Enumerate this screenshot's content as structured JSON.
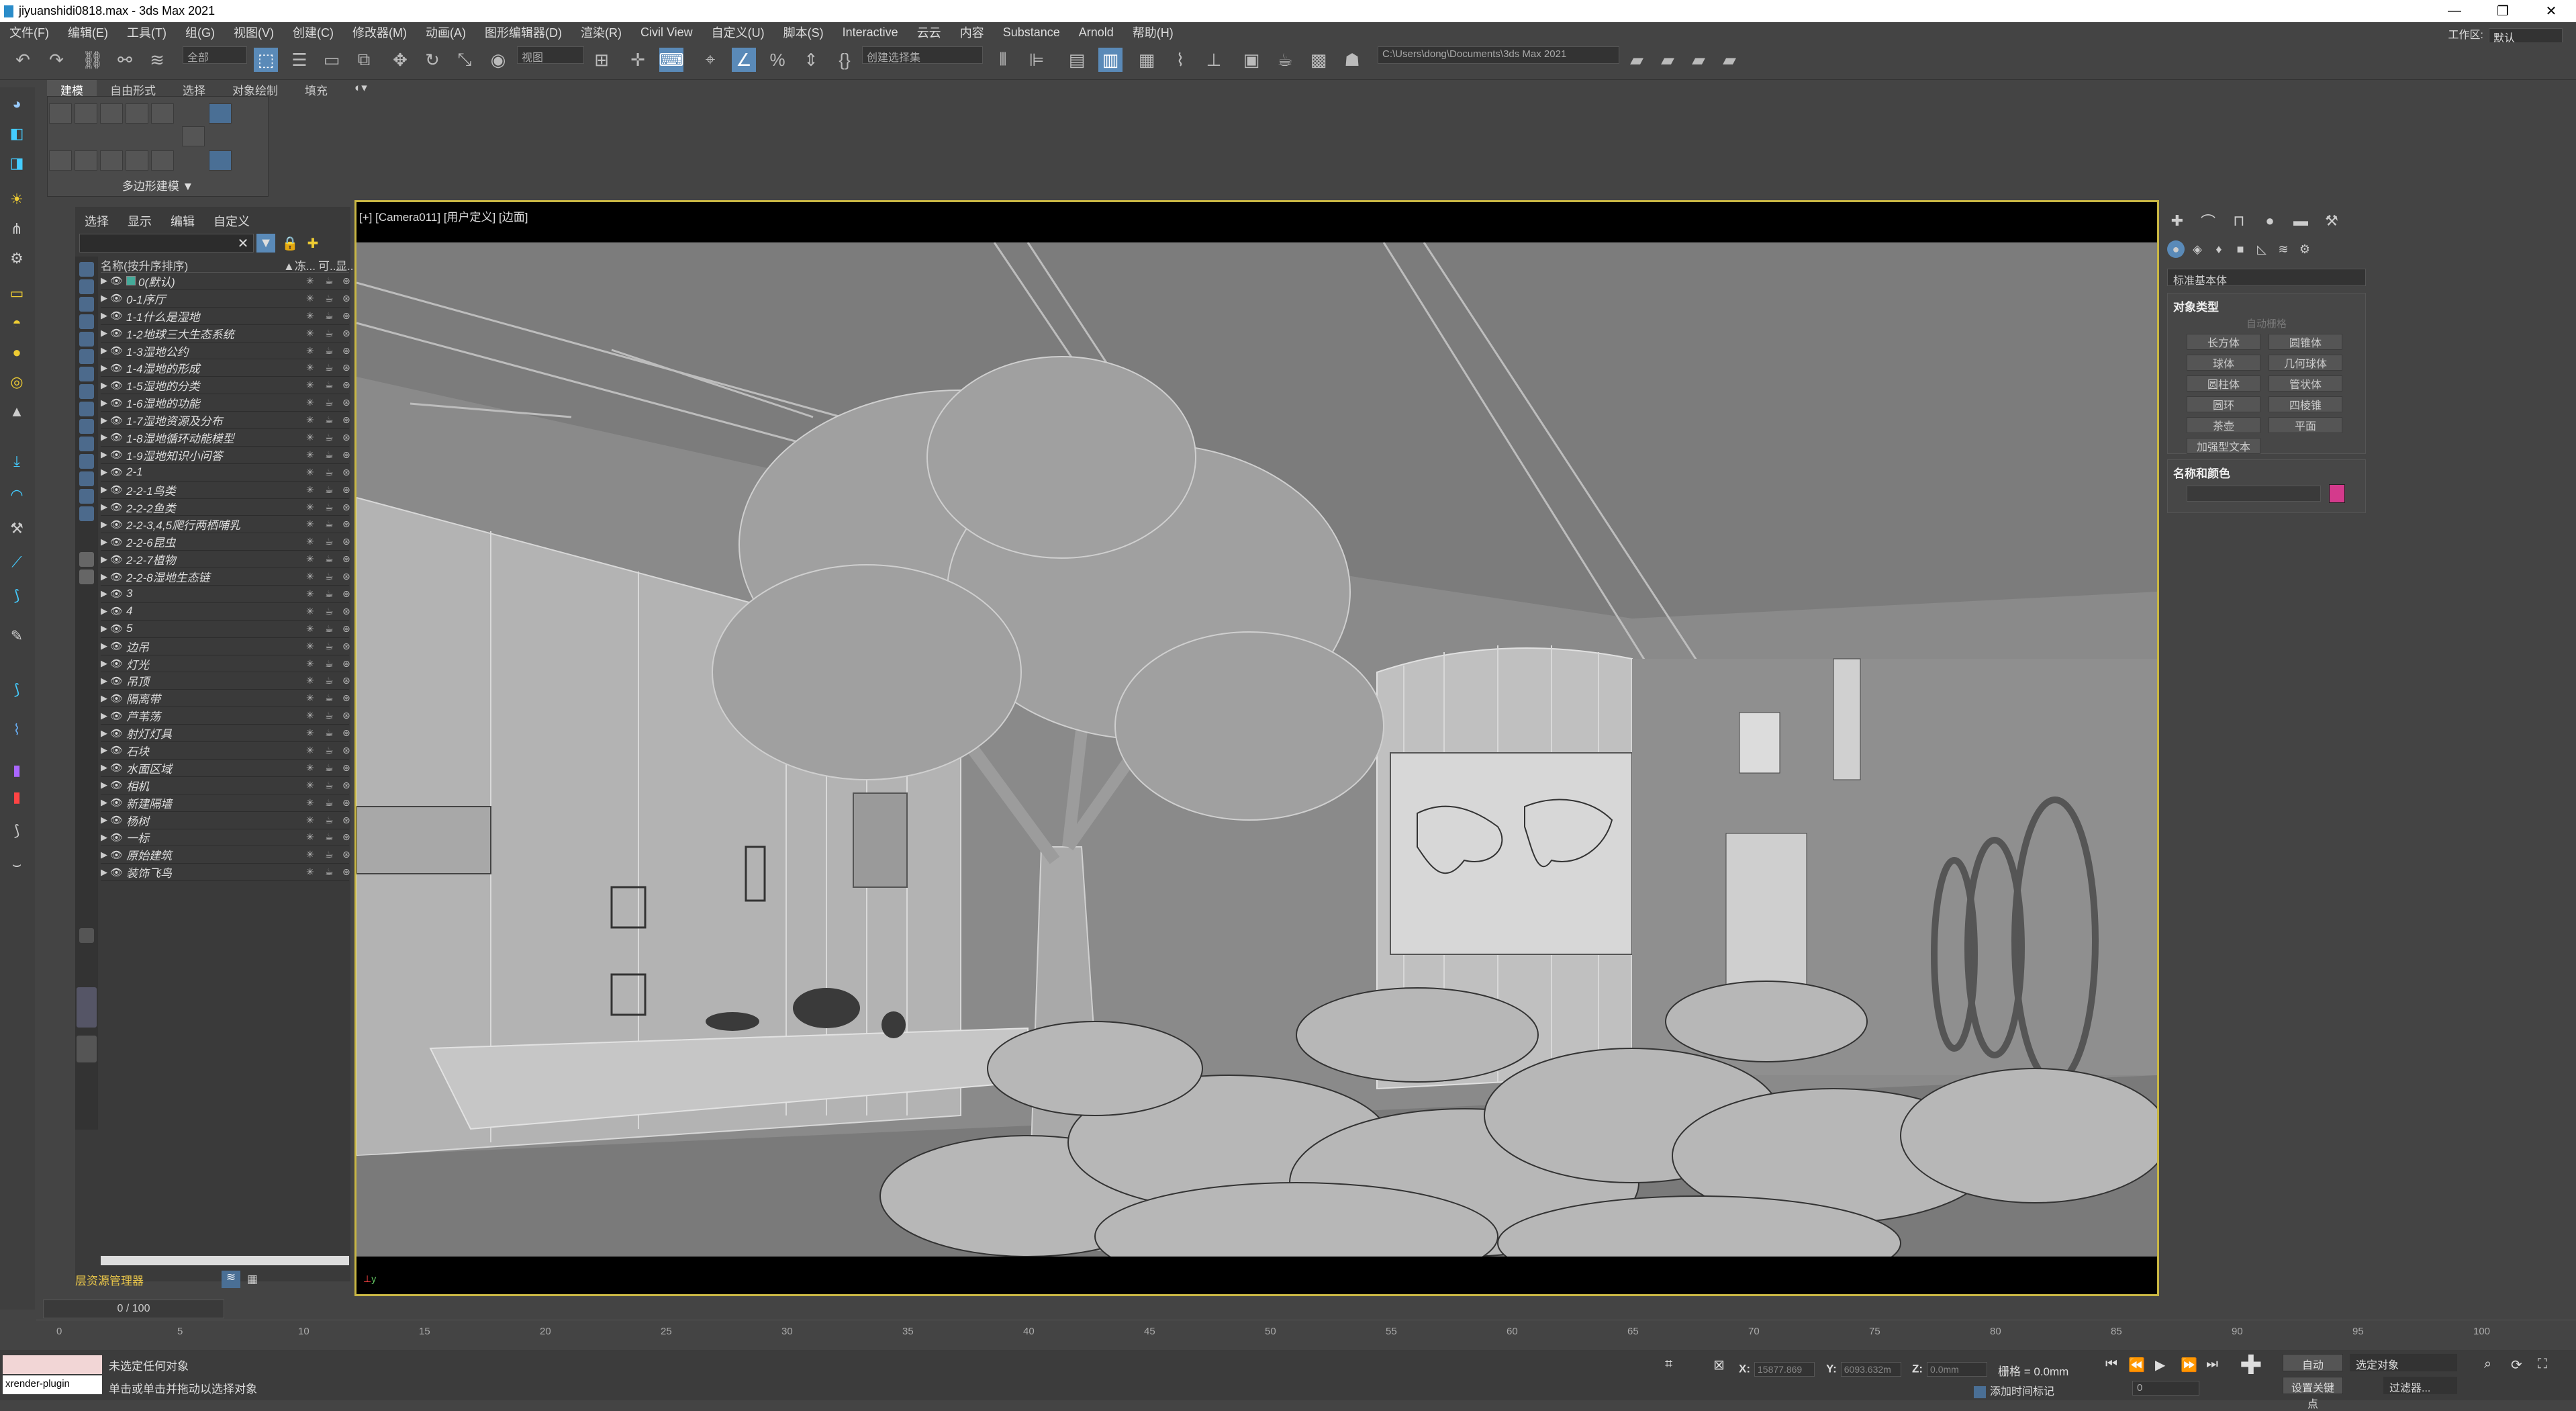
{
  "window": {
    "title": "jiyuanshidi0818.max - 3ds Max 2021",
    "minimize": "—",
    "restore": "❐",
    "close": "✕"
  },
  "menu": [
    "文件(F)",
    "编辑(E)",
    "工具(T)",
    "组(G)",
    "视图(V)",
    "创建(C)",
    "修改器(M)",
    "动画(A)",
    "图形编辑器(D)",
    "渲染(R)",
    "Civil View",
    "自定义(U)",
    "脚本(S)",
    "Interactive",
    "云云",
    "内容",
    "Substance",
    "Arnold",
    "帮助(H)"
  ],
  "workspace": {
    "label": "工作区:",
    "value": "默认"
  },
  "toolbar": {
    "filter": "全部",
    "refcoord": "视图",
    "selset": "创建选择集",
    "path": "C:\\Users\\dong\\Documents\\3ds Max 2021"
  },
  "ribbon": {
    "tabs": [
      "建模",
      "自由形式",
      "选择",
      "对象绘制",
      "填充"
    ],
    "group_label": "多边形建模 ▼"
  },
  "scene_explorer": {
    "tabs": [
      "选择",
      "显示",
      "编辑",
      "自定义"
    ],
    "header": {
      "name": "名称(按升序排序)",
      "c1": "▲冻...",
      "c2": "可...",
      "c3": "显..."
    },
    "footer": "层资源管理器",
    "rows": [
      "0(默认)",
      "0-1序厅",
      "1-1什么是湿地",
      "1-2地球三大生态系统",
      "1-3湿地公约",
      "1-4湿地的形成",
      "1-5湿地的分类",
      "1-6湿地的功能",
      "1-7湿地资源及分布",
      "1-8湿地循环动能模型",
      "1-9湿地知识小问答",
      "2-1",
      "2-2-1鸟类",
      "2-2-2鱼类",
      "2-2-3,4,5爬行两栖哺乳",
      "2-2-6昆虫",
      "2-2-7植物",
      "2-2-8湿地生态链",
      "3",
      "4",
      "5",
      "边吊",
      "灯光",
      "吊顶",
      "隔离带",
      "芦苇荡",
      "射灯灯具",
      "石块",
      "水面区域",
      "相机",
      "新建隔墙",
      "杨树",
      "一标",
      "原始建筑",
      "装饰飞鸟"
    ]
  },
  "viewport": {
    "label": "[+] [Camera011] [用户定义] [边面]"
  },
  "command_panel": {
    "dropdown": "标准基本体",
    "rollout1": "对象类型",
    "autogrid": "自动栅格",
    "buttons": [
      "长方体",
      "圆锥体",
      "球体",
      "几何球体",
      "圆柱体",
      "管状体",
      "圆环",
      "四棱锥",
      "茶壶",
      "平面",
      "加强型文本"
    ],
    "rollout2": "名称和颜色",
    "color": "#d43a8c"
  },
  "timeline": {
    "slider": "0 / 100",
    "ticks": [
      "0",
      "5",
      "10",
      "15",
      "20",
      "25",
      "30",
      "35",
      "40",
      "45",
      "50",
      "55",
      "60",
      "65",
      "70",
      "75",
      "80",
      "85",
      "90",
      "95",
      "100"
    ]
  },
  "status": {
    "line1": "未选定任何对象",
    "line2": "单击或单击并拖动以选择对象",
    "script_label": "xrender-plugin",
    "x_label": "X:",
    "x_val": "15877.869",
    "y_label": "Y:",
    "y_val": "6093.632m",
    "z_label": "Z:",
    "z_val": "0.0mm",
    "grid": "栅格 = 0.0mm",
    "add_tag": "添加时间标记",
    "auto": "自动",
    "selected": "选定对象",
    "set_key": "设置关键点",
    "filter": "过滤器...",
    "frame": "0"
  }
}
